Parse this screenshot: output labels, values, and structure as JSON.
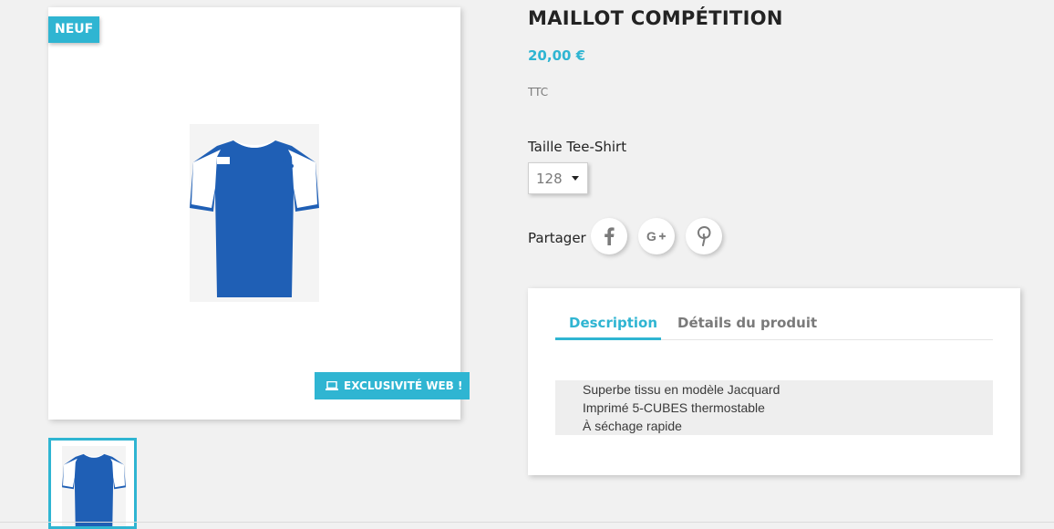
{
  "product": {
    "badge_new": "NEUF",
    "badge_web": "EXCLUSIVITÉ WEB !",
    "title": "MAILLOT COMPÉTITION",
    "price": "20,00 €",
    "tax": "TTC"
  },
  "variant": {
    "label": "Taille Tee-Shirt",
    "selected": "128"
  },
  "share": {
    "label": "Partager",
    "buttons": [
      {
        "icon": "facebook-icon",
        "glyph": "f"
      },
      {
        "icon": "google-plus-icon",
        "glyph": "G+"
      },
      {
        "icon": "pinterest-icon",
        "glyph": "P"
      }
    ]
  },
  "tabs": {
    "items": [
      {
        "label": "Description",
        "active": true
      },
      {
        "label": "Détails du produit",
        "active": false
      }
    ],
    "description_lines": [
      "Superbe tissu en modèle Jacquard",
      "Imprimé 5-CUBES thermostable",
      "À séchage rapide"
    ]
  },
  "colors": {
    "accent": "#2fb5d2",
    "shirt_blue": "#1f5fb5",
    "background": "#f1f1f1"
  }
}
